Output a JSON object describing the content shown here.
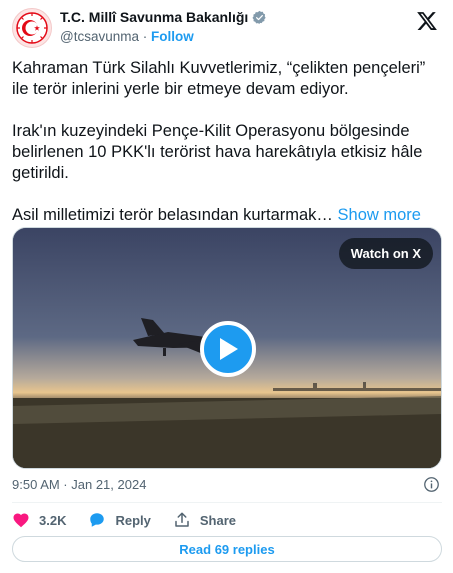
{
  "author": {
    "display_name": "T.C. Millî Savunma Bakanlığı",
    "handle": "@tcsavunma",
    "separator": "·",
    "follow_label": "Follow",
    "avatar_icon": "crescent-star-emblem-icon",
    "verified_icon": "verified-badge-icon"
  },
  "platform_icon": "x-logo-icon",
  "tweet": {
    "paragraphs": [
      "Kahraman Türk Silahlı Kuvvetlerimiz, “çelikten pençeleri” ile terör inlerini yerle bir etmeye devam ediyor.",
      "Irak'ın kuzeyindeki Pençe-Kilit Operasyonu bölgesinde belirlenen 10 PKK'lı terörist hava harekâtıyla etkisiz hâle getirildi."
    ],
    "truncated_text": "Asil milletimizi terör belasından kurtarmak…",
    "show_more_label": "Show more"
  },
  "media": {
    "watch_label": "Watch on X",
    "play_icon": "play-icon"
  },
  "meta": {
    "timestamp": "9:50 AM · Jan 21, 2024",
    "info_icon": "info-icon"
  },
  "actions": {
    "likes_count": "3.2K",
    "reply_label": "Reply",
    "share_label": "Share"
  },
  "read_replies_label": "Read 69 replies",
  "colors": {
    "accent": "#1d9bf0",
    "like": "#f91880",
    "secondary_text": "#536471",
    "text": "#0f1419"
  }
}
